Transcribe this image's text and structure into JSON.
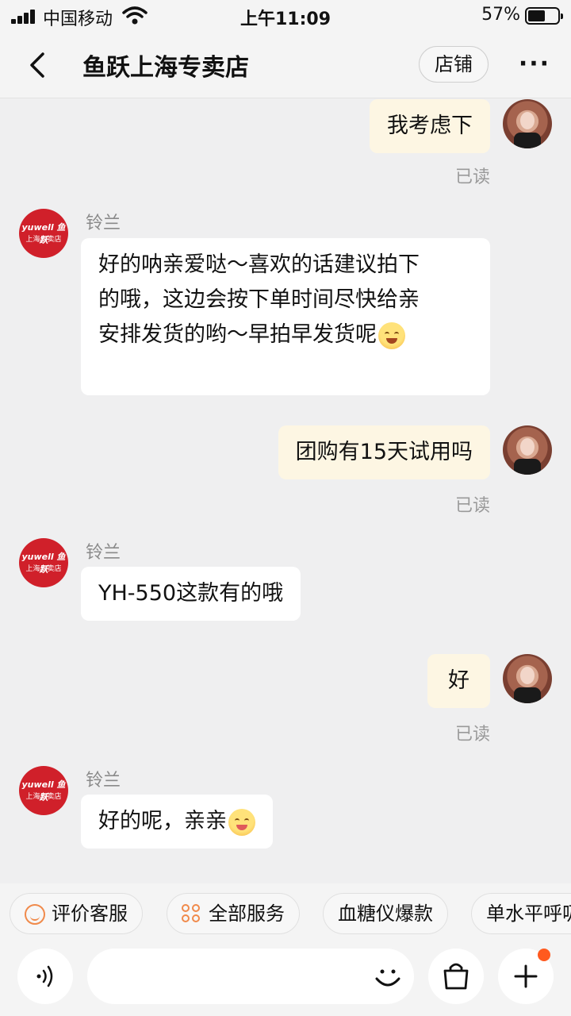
{
  "status_bar": {
    "carrier": "中国移动",
    "time": "上午11:09",
    "battery_pct": "57%",
    "battery_level": 0.57
  },
  "header": {
    "title": "鱼跃上海专卖店",
    "shop_button": "店铺",
    "more_label": "···"
  },
  "shop_avatar": {
    "brand": "yuwell 鱼跃",
    "store": "上海专卖店"
  },
  "messages": [
    {
      "side": "out",
      "text": "我考虑下",
      "status": "已读"
    },
    {
      "side": "in",
      "sender": "铃兰",
      "lines": [
        "好的呐亲爱哒～喜欢的话建议拍下",
        "的哦，这边会按下单时间尽快给亲",
        "安排发货的哟～早拍早发货呢"
      ],
      "emoji": "laughing-face"
    },
    {
      "side": "out",
      "text": "团购有15天试用吗",
      "status": "已读"
    },
    {
      "side": "in",
      "sender": "铃兰",
      "text": "YH-550这款有的哦"
    },
    {
      "side": "out",
      "text": "好",
      "status": "已读"
    },
    {
      "side": "in",
      "sender": "铃兰",
      "text": "好的呢，亲亲",
      "emoji": "blush-face"
    }
  ],
  "quick_replies": [
    "评价客服",
    "全部服务",
    "血糖仪爆款",
    "单水平呼吸"
  ],
  "input": {
    "placeholder": ""
  },
  "colors": {
    "accent": "#ff5a1f",
    "out_bubble": "#fdf6e3",
    "in_bubble": "#ffffff",
    "shop_red": "#d0202a"
  }
}
